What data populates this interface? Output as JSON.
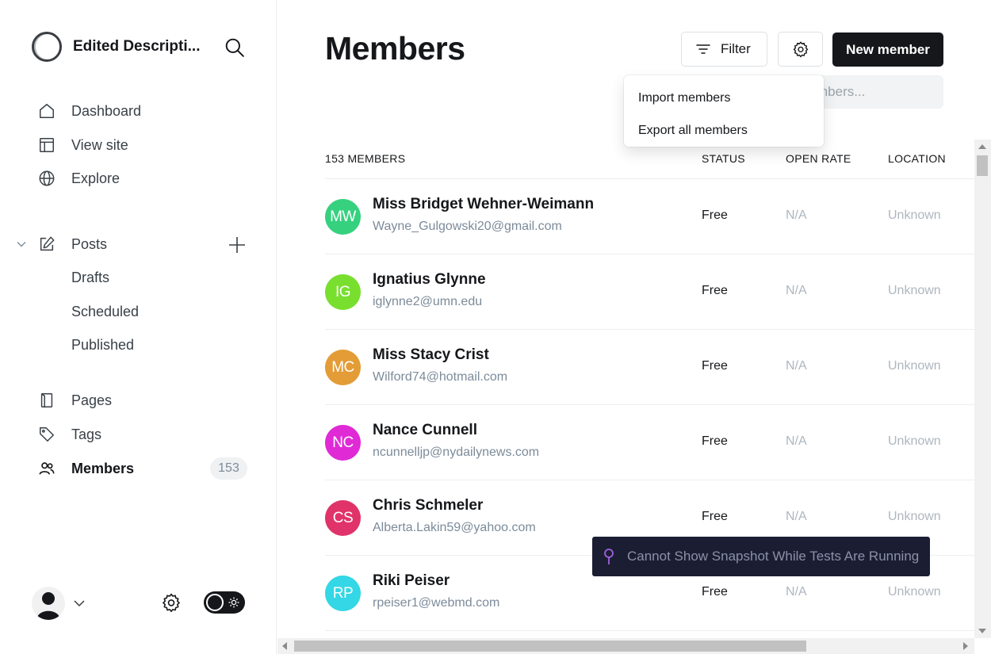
{
  "sidebar": {
    "brand_name": "Edited Descripti...",
    "nav": [
      {
        "label": "Dashboard",
        "icon": "home-icon"
      },
      {
        "label": "View site",
        "icon": "layout-icon"
      },
      {
        "label": "Explore",
        "icon": "globe-icon"
      }
    ],
    "posts": {
      "label": "Posts",
      "sub": [
        "Drafts",
        "Scheduled",
        "Published"
      ]
    },
    "pages_label": "Pages",
    "tags_label": "Tags",
    "members_label": "Members",
    "members_count": "153"
  },
  "main": {
    "title": "Members",
    "filter_label": "Filter",
    "new_member_label": "New member",
    "search_placeholder": "mbers...",
    "dropdown": [
      "Import members",
      "Export all members"
    ],
    "columns": {
      "members": "153 MEMBERS",
      "status": "STATUS",
      "open_rate": "OPEN RATE",
      "location": "LOCATION"
    },
    "rows": [
      {
        "initials": "MW",
        "name": "Miss Bridget Wehner-Weimann",
        "email": "Wayne_Gulgowski20@gmail.com",
        "status": "Free",
        "open_rate": "N/A",
        "location": "Unknown",
        "color": "#35d17f"
      },
      {
        "initials": "IG",
        "name": "Ignatius Glynne",
        "email": "iglynne2@umn.edu",
        "status": "Free",
        "open_rate": "N/A",
        "location": "Unknown",
        "color": "#79df2e"
      },
      {
        "initials": "MC",
        "name": "Miss Stacy Crist",
        "email": "Wilford74@hotmail.com",
        "status": "Free",
        "open_rate": "N/A",
        "location": "Unknown",
        "color": "#e39c36"
      },
      {
        "initials": "NC",
        "name": "Nance Cunnell",
        "email": "ncunnelljp@nydailynews.com",
        "status": "Free",
        "open_rate": "N/A",
        "location": "Unknown",
        "color": "#e02ad6"
      },
      {
        "initials": "CS",
        "name": "Chris Schmeler",
        "email": "Alberta.Lakin59@yahoo.com",
        "status": "Free",
        "open_rate": "N/A",
        "location": "Unknown",
        "color": "#e03369"
      },
      {
        "initials": "RP",
        "name": "Riki Peiser",
        "email": "rpeiser1@webmd.com",
        "status": "Free",
        "open_rate": "N/A",
        "location": "Unknown",
        "color": "#33d7e6"
      }
    ]
  },
  "snapshot_message": "Cannot Show Snapshot While Tests Are Running"
}
